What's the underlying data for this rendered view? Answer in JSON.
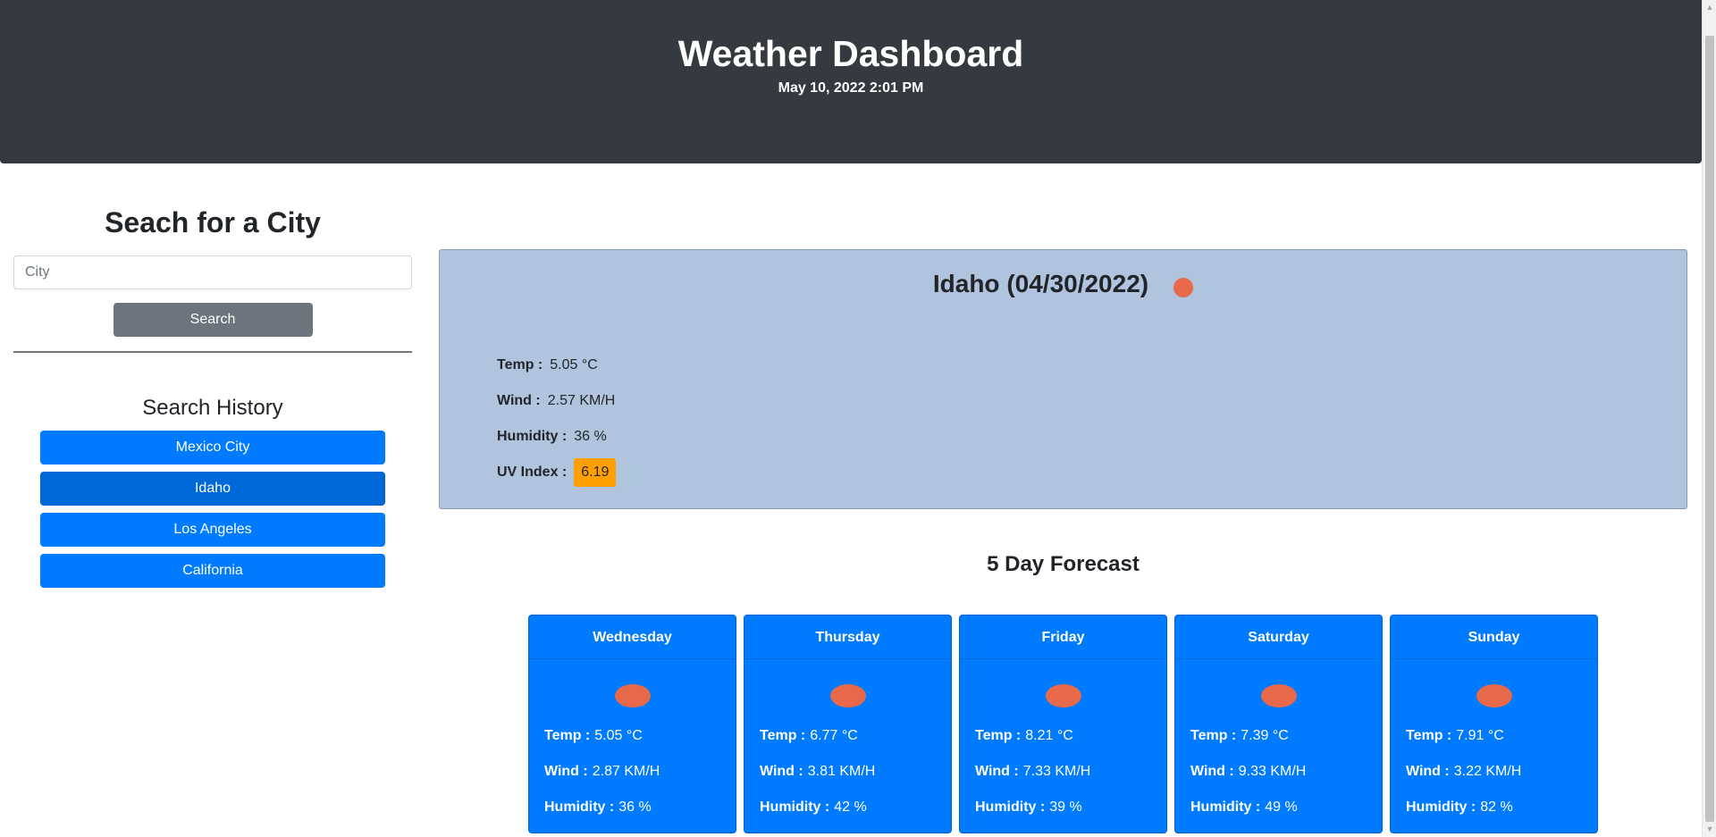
{
  "header": {
    "title": "Weather Dashboard",
    "datetime": "May 10, 2022 2:01 PM"
  },
  "sidebar": {
    "title": "Seach for a City",
    "input_placeholder": "City",
    "input_value": "",
    "search_label": "Search",
    "history_title": "Search History",
    "history": [
      {
        "label": "Mexico City"
      },
      {
        "label": "Idaho",
        "active": true
      },
      {
        "label": "Los Angeles"
      },
      {
        "label": "California"
      }
    ]
  },
  "current": {
    "title": "Idaho (04/30/2022)",
    "icon": "weather-icon",
    "temp_label": "Temp :",
    "temp_value": "5.05 °C",
    "wind_label": "Wind :",
    "wind_value": "2.57 KM/H",
    "humidity_label": "Humidity :",
    "humidity_value": "36 %",
    "uv_label": "UV Index :",
    "uv_value": "6.19",
    "uv_color": "#ff9f00"
  },
  "forecast": {
    "title": "5 Day Forecast",
    "days": [
      {
        "day": "Wednesday",
        "temp_label": "Temp :",
        "temp": "5.05 °C",
        "wind_label": "Wind :",
        "wind": "2.87 KM/H",
        "humidity_label": "Humidity :",
        "humidity": "36 %"
      },
      {
        "day": "Thursday",
        "temp_label": "Temp :",
        "temp": "6.77 °C",
        "wind_label": "Wind :",
        "wind": "3.81 KM/H",
        "humidity_label": "Humidity :",
        "humidity": "42 %"
      },
      {
        "day": "Friday",
        "temp_label": "Temp :",
        "temp": "8.21 °C",
        "wind_label": "Wind :",
        "wind": "7.33 KM/H",
        "humidity_label": "Humidity :",
        "humidity": "39 %"
      },
      {
        "day": "Saturday",
        "temp_label": "Temp :",
        "temp": "7.39 °C",
        "wind_label": "Wind :",
        "wind": "9.33 KM/H",
        "humidity_label": "Humidity :",
        "humidity": "49 %"
      },
      {
        "day": "Sunday",
        "temp_label": "Temp :",
        "temp": "7.91 °C",
        "wind_label": "Wind :",
        "wind": "3.22 KM/H",
        "humidity_label": "Humidity :",
        "humidity": "82 %"
      }
    ]
  },
  "colors": {
    "header_bg": "#343a40",
    "primary": "#007bff",
    "current_bg": "#b0c4de",
    "weather_icon": "#e8684a"
  }
}
